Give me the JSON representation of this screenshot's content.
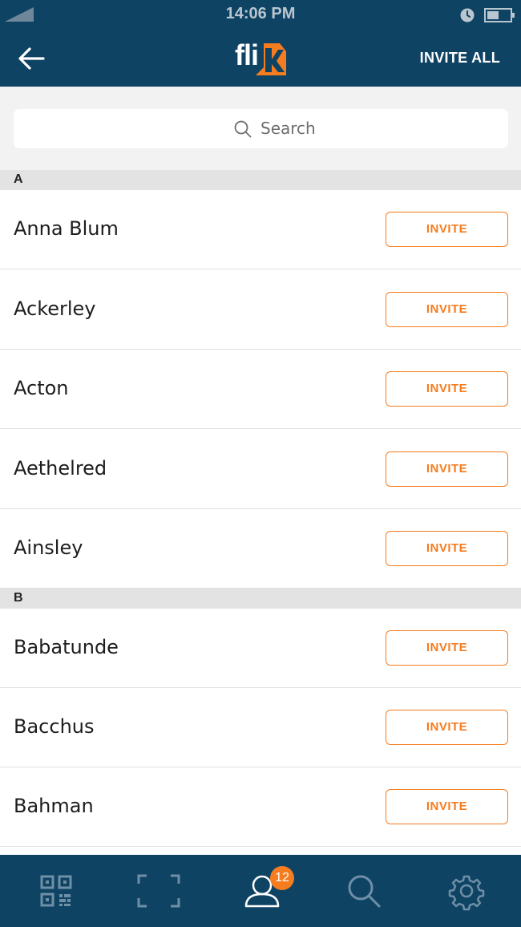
{
  "status_bar": {
    "time": "14:06 PM"
  },
  "header": {
    "logo_text": "fli",
    "invite_all_label": "INVITE ALL",
    "back_icon": "arrow-left-icon"
  },
  "search": {
    "placeholder": "Search",
    "value": ""
  },
  "sections": [
    {
      "letter": "A",
      "contacts": [
        {
          "name": "Anna Blum",
          "button": "INVITE"
        },
        {
          "name": "Ackerley",
          "button": "INVITE"
        },
        {
          "name": "Acton",
          "button": "INVITE"
        },
        {
          "name": "Aethelred",
          "button": "INVITE"
        },
        {
          "name": "Ainsley",
          "button": "INVITE"
        }
      ]
    },
    {
      "letter": "B",
      "contacts": [
        {
          "name": "Babatunde",
          "button": "INVITE"
        },
        {
          "name": "Bacchus",
          "button": "INVITE"
        },
        {
          "name": "Bahman",
          "button": "INVITE"
        }
      ]
    }
  ],
  "bottom_nav": {
    "items": [
      "qr-code-icon",
      "scan-frame-icon",
      "contacts-icon",
      "search-icon",
      "settings-gear-icon"
    ],
    "active": "contacts-icon",
    "badge_count": "12"
  },
  "colors": {
    "brand_navy": "#0f4364",
    "accent_orange": "#f57c1f"
  }
}
